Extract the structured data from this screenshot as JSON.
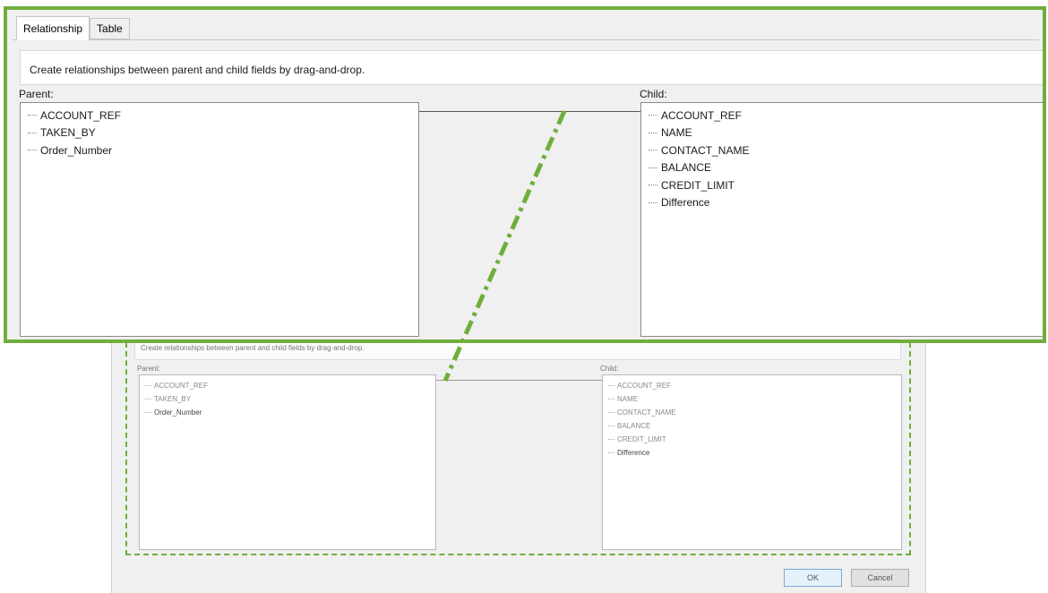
{
  "zoom": {
    "tabs": [
      {
        "label": "Relationship"
      },
      {
        "label": "Table"
      }
    ],
    "instructions": "Create relationships between parent and child fields by drag-and-drop.",
    "parent_label": "Parent:",
    "child_label": "Child:",
    "parent_fields": [
      "ACCOUNT_REF",
      "TAKEN_BY",
      "Order_Number"
    ],
    "child_fields": [
      "ACCOUNT_REF",
      "NAME",
      "CONTACT_NAME",
      "BALANCE",
      "CREDIT_LIMIT",
      "Difference"
    ]
  },
  "dialog": {
    "instructions": "Create relationships between parent and child fields by drag-and-drop.",
    "parent_label": "Parent:",
    "child_label": "Child:",
    "parent_fields": [
      "ACCOUNT_REF",
      "TAKEN_BY",
      "Order_Number"
    ],
    "child_fields": [
      "ACCOUNT_REF",
      "NAME",
      "CONTACT_NAME",
      "BALANCE",
      "CREDIT_LIMIT",
      "Difference"
    ],
    "ok_label": "OK",
    "cancel_label": "Cancel"
  },
  "colors": {
    "highlight": "#6fae3b"
  }
}
